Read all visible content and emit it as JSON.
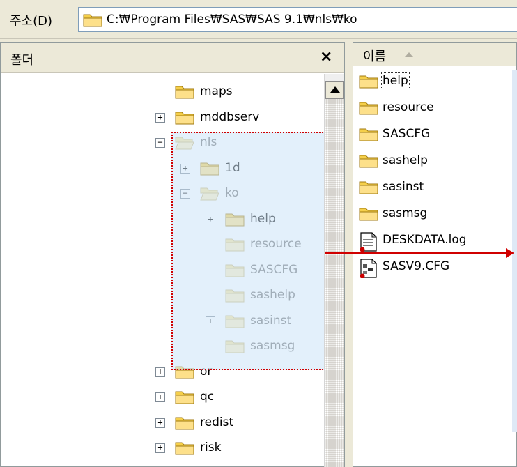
{
  "address_bar": {
    "label": "주소(D)",
    "path": "C:₩Program Files₩SAS₩SAS 9.1₩nls₩ko"
  },
  "folder_pane": {
    "title": "폴더",
    "close_glyph": "×",
    "tree": [
      {
        "label": "maps",
        "level": 0,
        "expander": "",
        "faded": false,
        "open": false
      },
      {
        "label": "mddbserv",
        "level": 0,
        "expander": "+",
        "faded": false,
        "open": false
      },
      {
        "label": "nls",
        "level": 0,
        "expander": "−",
        "faded": true,
        "open": true
      },
      {
        "label": "1d",
        "level": 1,
        "expander": "+",
        "faded": false,
        "open": false
      },
      {
        "label": "ko",
        "level": 1,
        "expander": "−",
        "faded": true,
        "open": true
      },
      {
        "label": "help",
        "level": 2,
        "expander": "+",
        "faded": false,
        "open": false
      },
      {
        "label": "resource",
        "level": 2,
        "expander": "",
        "faded": true,
        "open": false
      },
      {
        "label": "SASCFG",
        "level": 2,
        "expander": "",
        "faded": true,
        "open": false
      },
      {
        "label": "sashelp",
        "level": 2,
        "expander": "",
        "faded": true,
        "open": false
      },
      {
        "label": "sasinst",
        "level": 2,
        "expander": "+",
        "faded": true,
        "open": false
      },
      {
        "label": "sasmsg",
        "level": 2,
        "expander": "",
        "faded": true,
        "open": false
      },
      {
        "label": "or",
        "level": 0,
        "expander": "+",
        "faded": false,
        "open": false
      },
      {
        "label": "qc",
        "level": 0,
        "expander": "+",
        "faded": false,
        "open": false
      },
      {
        "label": "redist",
        "level": 0,
        "expander": "+",
        "faded": false,
        "open": false
      },
      {
        "label": "risk",
        "level": 0,
        "expander": "+",
        "faded": false,
        "open": false
      }
    ]
  },
  "file_pane": {
    "column_header": "이름",
    "files": [
      {
        "name": "help",
        "icon": "folder-icon",
        "focused": true
      },
      {
        "name": "resource",
        "icon": "folder-icon",
        "focused": false
      },
      {
        "name": "SASCFG",
        "icon": "folder-icon",
        "focused": false
      },
      {
        "name": "sashelp",
        "icon": "folder-icon",
        "focused": false
      },
      {
        "name": "sasinst",
        "icon": "folder-icon",
        "focused": false
      },
      {
        "name": "sasmsg",
        "icon": "folder-icon",
        "focused": false
      },
      {
        "name": "DESKDATA.log",
        "icon": "log-file-icon",
        "focused": false
      },
      {
        "name": "SASV9.CFG",
        "icon": "config-file-icon",
        "focused": false
      }
    ]
  },
  "colors": {
    "annotation": "#d00000",
    "selection_fill": "#cce4f7",
    "folder": "#f5cf4a"
  }
}
